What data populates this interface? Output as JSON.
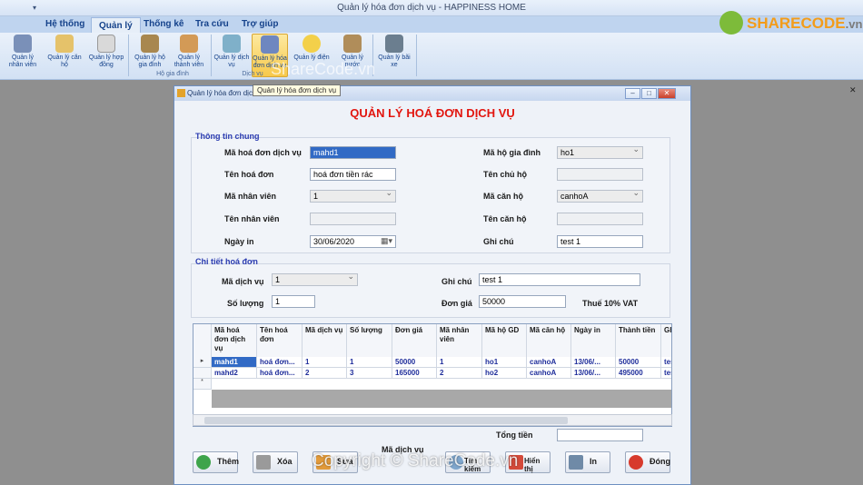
{
  "app": {
    "title": "Quản lý hóa đơn dịch vụ - HAPPINESS HOME"
  },
  "tabs": [
    "Hệ thống",
    "Quản lý",
    "Thống kê",
    "Tra cứu",
    "Trợ giúp"
  ],
  "ribbon": {
    "buttons": [
      {
        "label": "Quản lý nhân viên"
      },
      {
        "label": "Quản lý căn hộ"
      },
      {
        "label": "Quản lý hợp đồng"
      },
      {
        "label": "Quản lý hộ gia đình"
      },
      {
        "label": "Quản lý thành viên"
      },
      {
        "label": "Quản lý dịch vụ"
      },
      {
        "label": "Quản lý hóa đơn dịch vụ"
      },
      {
        "label": "Quản lý điện"
      },
      {
        "label": "Quản lý nước"
      },
      {
        "label": "Quản lý bãi xe"
      }
    ],
    "group_labels": [
      "Hộ gia đình",
      "Dịch vụ"
    ],
    "tooltip": "Quản lý hóa đơn dịch vụ"
  },
  "logo": {
    "text_main": "SHARECODE",
    "text_suffix": ".vn"
  },
  "form": {
    "title": "Quản lý hóa đơn dịch vụ",
    "heading": "QUẢN LÝ HOÁ ĐƠN DỊCH VỤ",
    "general_section": "Thông tin chung",
    "detail_section": "Chi tiết hoá đơn",
    "fields": {
      "ma_hd_label": "Mã hoá đơn dịch vụ",
      "ma_hd": "mahd1",
      "ten_hd_label": "Tên hoá đơn",
      "ten_hd": "hoá đơn tiền rác",
      "ma_nv_label": "Mã nhân viên",
      "ma_nv": "1",
      "ten_nv_label": "Tên nhân viên",
      "ten_nv": "",
      "ngay_in_label": "Ngày in",
      "ngay_in": "30/06/2020",
      "ma_hgd_label": "Mã hộ gia đình",
      "ma_hgd": "ho1",
      "ten_chu_ho_label": "Tên chủ hộ",
      "ten_chu_ho": "",
      "ma_can_ho_label": "Mã căn hộ",
      "ma_can_ho": "canhoA",
      "ten_can_ho_label": "Tên căn hộ",
      "ten_can_ho": "",
      "ghi_chu_label": "Ghi chú",
      "ghi_chu": "test 1",
      "ma_dv_label": "Mã dịch vụ",
      "ma_dv": "1",
      "so_luong_label": "Số lượng",
      "so_luong": "1",
      "ghi_chu2_label": "Ghi chú",
      "ghi_chu2": "test 1",
      "don_gia_label": "Đơn giá",
      "don_gia": "50000",
      "vat_label": "Thuế 10% VAT",
      "tong_tien_label": "Tổng tiền",
      "tong_tien": ""
    },
    "grid": {
      "headers": [
        "Mã hoá đơn dịch vụ",
        "Tên hoá đơn",
        "Mã dịch vụ",
        "Số lượng",
        "Đơn giá",
        "Mã nhân viên",
        "Mã hộ GD",
        "Mã căn hộ",
        "Ngày in",
        "Thành tiền",
        "Gh"
      ],
      "rows": [
        [
          "mahd1",
          "hoá đơn...",
          "1",
          "1",
          "50000",
          "1",
          "ho1",
          "canhoA",
          "13/06/...",
          "50000",
          "tes"
        ],
        [
          "mahd2",
          "hoá đơn...",
          "2",
          "3",
          "165000",
          "2",
          "ho2",
          "canhoA",
          "13/06/...",
          "495000",
          "tes"
        ]
      ],
      "row_markers": [
        "▸",
        "",
        "*"
      ]
    },
    "buttons": {
      "them": "Thêm",
      "xoa": "Xóa",
      "sua": "Sửa",
      "tim_kiem_field": "Mã dịch vụ",
      "tim_kiem": "Tìm kiếm",
      "hien_thi": "Hiển thị",
      "in": "In",
      "dong": "Đóng"
    }
  },
  "watermark": "Copyright © ShareCode.vn",
  "watermark_top": "ShareCode.vn"
}
